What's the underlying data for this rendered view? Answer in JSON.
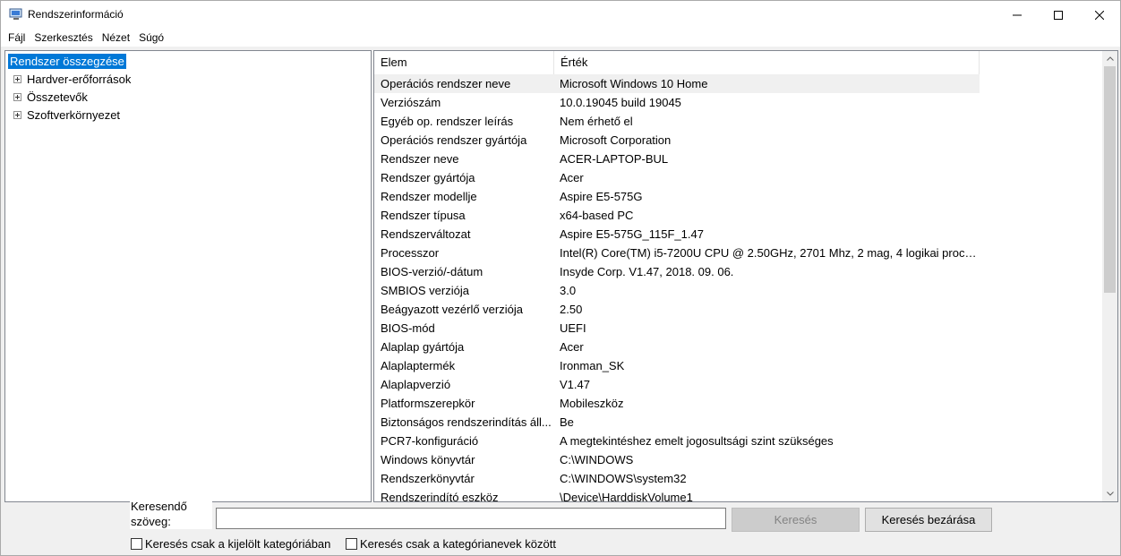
{
  "window": {
    "title": "Rendszerinformáció",
    "icon": "system-info-icon"
  },
  "menu": [
    "Fájl",
    "Szerkesztés",
    "Nézet",
    "Súgó"
  ],
  "tree": [
    {
      "label": "Rendszer összegzése",
      "expandable": false,
      "selected": true
    },
    {
      "label": "Hardver-erőforrások",
      "expandable": true,
      "selected": false
    },
    {
      "label": "Összetevők",
      "expandable": true,
      "selected": false
    },
    {
      "label": "Szoftverkörnyezet",
      "expandable": true,
      "selected": false
    }
  ],
  "table": {
    "headers": {
      "elem": "Elem",
      "value": "Érték"
    },
    "rows": [
      {
        "elem": "Operációs rendszer neve",
        "value": "Microsoft Windows 10 Home"
      },
      {
        "elem": "Verziószám",
        "value": "10.0.19045 build 19045"
      },
      {
        "elem": "Egyéb op. rendszer leírás",
        "value": "Nem érhető el"
      },
      {
        "elem": "Operációs rendszer gyártója",
        "value": "Microsoft Corporation"
      },
      {
        "elem": "Rendszer neve",
        "value": "ACER-LAPTOP-BUL"
      },
      {
        "elem": "Rendszer gyártója",
        "value": "Acer"
      },
      {
        "elem": "Rendszer modellje",
        "value": "Aspire E5-575G"
      },
      {
        "elem": "Rendszer típusa",
        "value": "x64-based PC"
      },
      {
        "elem": "Rendszerváltozat",
        "value": "Aspire E5-575G_115F_1.47"
      },
      {
        "elem": "Processzor",
        "value": "Intel(R) Core(TM) i5-7200U CPU @ 2.50GHz, 2701 Mhz, 2 mag, 4 logikai proce..."
      },
      {
        "elem": "BIOS-verzió/-dátum",
        "value": "Insyde Corp. V1.47, 2018. 09. 06."
      },
      {
        "elem": "SMBIOS verziója",
        "value": "3.0"
      },
      {
        "elem": "Beágyazott vezérlő verziója",
        "value": "2.50"
      },
      {
        "elem": "BIOS-mód",
        "value": "UEFI"
      },
      {
        "elem": "Alaplap gyártója",
        "value": "Acer"
      },
      {
        "elem": "Alaplaptermék",
        "value": "Ironman_SK"
      },
      {
        "elem": "Alaplapverzió",
        "value": "V1.47"
      },
      {
        "elem": "Platformszerepkör",
        "value": "Mobileszköz"
      },
      {
        "elem": "Biztonságos rendszerindítás áll...",
        "value": "Be"
      },
      {
        "elem": "PCR7-konfiguráció",
        "value": "A megtekintéshez emelt jogosultsági szint szükséges"
      },
      {
        "elem": "Windows könyvtár",
        "value": "C:\\WINDOWS"
      },
      {
        "elem": "Rendszerkönyvtár",
        "value": "C:\\WINDOWS\\system32"
      },
      {
        "elem": "Rendszerindító eszköz",
        "value": "\\Device\\HarddiskVolume1"
      }
    ]
  },
  "search": {
    "label": "Keresendő szöveg:",
    "value": "",
    "search_button": "Keresés",
    "close_button": "Keresés bezárása",
    "checkbox_selected_category": "Keresés csak a kijelölt kategóriában",
    "checkbox_category_names": "Keresés csak a kategórianevek között"
  },
  "colors": {
    "selection": "#0078d7",
    "row_highlight": "#f0f0f0"
  }
}
